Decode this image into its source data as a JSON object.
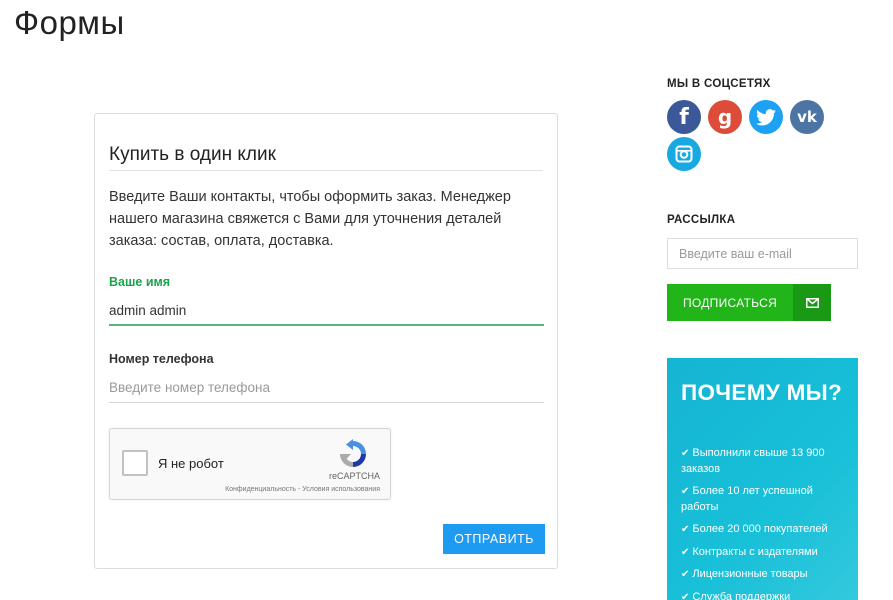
{
  "page": {
    "title": "Формы"
  },
  "form": {
    "title": "Купить в один клик",
    "description": "Введите Ваши контакты, чтобы оформить заказ. Менеджер нашего магазина свяжется с Вами для уточнения деталей заказа: состав, оплата, доставка.",
    "name_label": "Ваше имя",
    "name_value": "admin admin",
    "phone_label": "Номер телефона",
    "phone_placeholder": "Введите номер телефона",
    "recaptcha": {
      "label": "Я не робот",
      "brand": "reCAPTCHA",
      "links": "Конфиденциальность - Условия использования"
    },
    "submit_label": "ОТПРАВИТЬ"
  },
  "sidebar": {
    "social_heading": "МЫ В СОЦСЕТЯХ",
    "social": [
      {
        "name": "facebook",
        "glyph": "f",
        "color": "#3b5998"
      },
      {
        "name": "google-plus",
        "glyph": "g",
        "color": "#dd4b39"
      },
      {
        "name": "twitter",
        "glyph": "t",
        "color": "#1da1f2"
      },
      {
        "name": "vk",
        "glyph": "vk",
        "color": "#4c75a3"
      },
      {
        "name": "instagram",
        "glyph": "ig",
        "color": "#17a9e1"
      }
    ],
    "newsletter_heading": "РАССЫЛКА",
    "email_placeholder": "Введите ваш e-mail",
    "subscribe_label": "ПОДПИСАТЬСЯ",
    "why": {
      "title": "ПОЧЕМУ МЫ?",
      "items": [
        "Выполнили свыше 13 900 заказов",
        "Более 10 лет успешной работы",
        "Более 20 000 покупателей",
        "Контракты с издателями",
        "Лицензионные товары",
        "Служба поддержки"
      ]
    }
  }
}
